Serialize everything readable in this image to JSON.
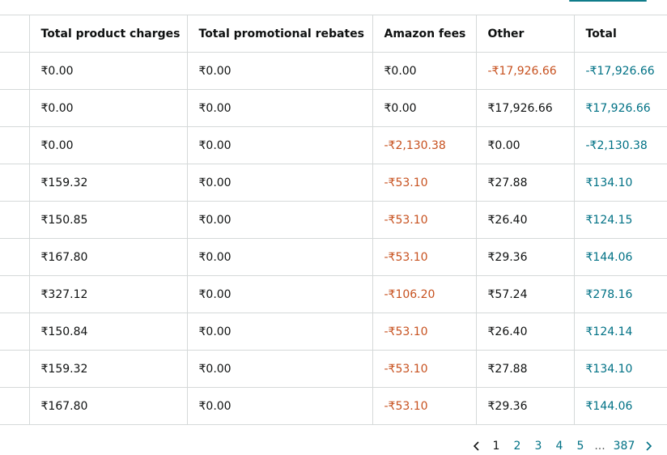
{
  "table": {
    "columns": [
      "Total product charges",
      "Total promotional rebates",
      "Amazon fees",
      "Other",
      "Total"
    ],
    "rows": [
      {
        "product_charges": "₹0.00",
        "promotional_rebates": "₹0.00",
        "amazon_fees": "₹0.00",
        "other": "-₹17,926.66",
        "total": "-₹17,926.66"
      },
      {
        "product_charges": "₹0.00",
        "promotional_rebates": "₹0.00",
        "amazon_fees": "₹0.00",
        "other": "₹17,926.66",
        "total": "₹17,926.66"
      },
      {
        "product_charges": "₹0.00",
        "promotional_rebates": "₹0.00",
        "amazon_fees": "-₹2,130.38",
        "other": "₹0.00",
        "total": "-₹2,130.38"
      },
      {
        "product_charges": "₹159.32",
        "promotional_rebates": "₹0.00",
        "amazon_fees": "-₹53.10",
        "other": "₹27.88",
        "total": "₹134.10"
      },
      {
        "product_charges": "₹150.85",
        "promotional_rebates": "₹0.00",
        "amazon_fees": "-₹53.10",
        "other": "₹26.40",
        "total": "₹124.15"
      },
      {
        "product_charges": "₹167.80",
        "promotional_rebates": "₹0.00",
        "amazon_fees": "-₹53.10",
        "other": "₹29.36",
        "total": "₹144.06"
      },
      {
        "product_charges": "₹327.12",
        "promotional_rebates": "₹0.00",
        "amazon_fees": "-₹106.20",
        "other": "₹57.24",
        "total": "₹278.16"
      },
      {
        "product_charges": "₹150.84",
        "promotional_rebates": "₹0.00",
        "amazon_fees": "-₹53.10",
        "other": "₹26.40",
        "total": "₹124.14"
      },
      {
        "product_charges": "₹159.32",
        "promotional_rebates": "₹0.00",
        "amazon_fees": "-₹53.10",
        "other": "₹27.88",
        "total": "₹134.10"
      },
      {
        "product_charges": "₹167.80",
        "promotional_rebates": "₹0.00",
        "amazon_fees": "-₹53.10",
        "other": "₹29.36",
        "total": "₹144.06"
      }
    ]
  },
  "pagination": {
    "prev_icon": "chevron-left-icon",
    "next_icon": "chevron-right-icon",
    "pages": [
      "1",
      "2",
      "3",
      "4",
      "5"
    ],
    "current_page": "1",
    "ellipsis": "...",
    "last_page": "387"
  },
  "colors": {
    "negative": "#c7511f",
    "total": "#007185",
    "link": "#007185",
    "border": "#d5d9d9"
  }
}
